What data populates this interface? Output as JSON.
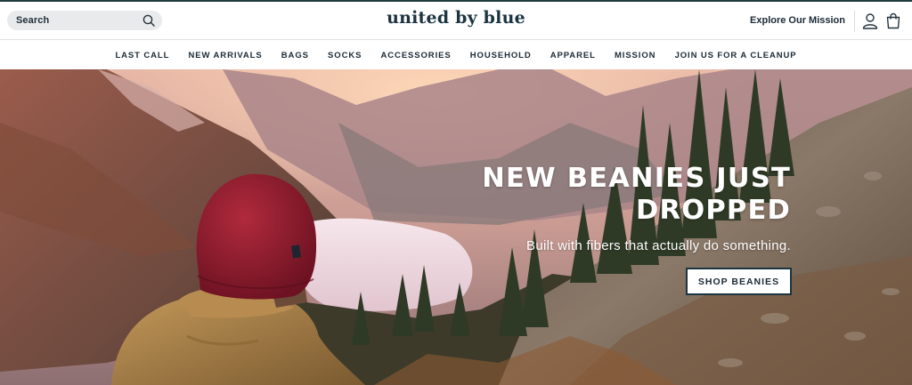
{
  "header": {
    "search_placeholder": "Search",
    "brand": "united by blue",
    "mission_link": "Explore Our Mission",
    "icons": [
      "search-icon",
      "account-icon",
      "cart-icon"
    ]
  },
  "nav": {
    "items": [
      {
        "label": "LAST CALL"
      },
      {
        "label": "NEW ARRIVALS"
      },
      {
        "label": "BAGS"
      },
      {
        "label": "SOCKS"
      },
      {
        "label": "ACCESSORIES"
      },
      {
        "label": "HOUSEHOLD"
      },
      {
        "label": "APPAREL"
      },
      {
        "label": "MISSION"
      },
      {
        "label": "JOIN US FOR A CLEANUP"
      }
    ]
  },
  "hero": {
    "heading_line1": "NEW BEANIES JUST",
    "heading_line2": "DROPPED",
    "subheading": "Built with fibers that actually do something.",
    "cta_label": "SHOP BEANIES"
  },
  "colors": {
    "brand_text": "#1b3440",
    "top_rule": "#1e3a3a",
    "search_bg": "#e9eaeb",
    "beanie_red": "#8e1a2b",
    "jacket_tan": "#a07a45"
  }
}
